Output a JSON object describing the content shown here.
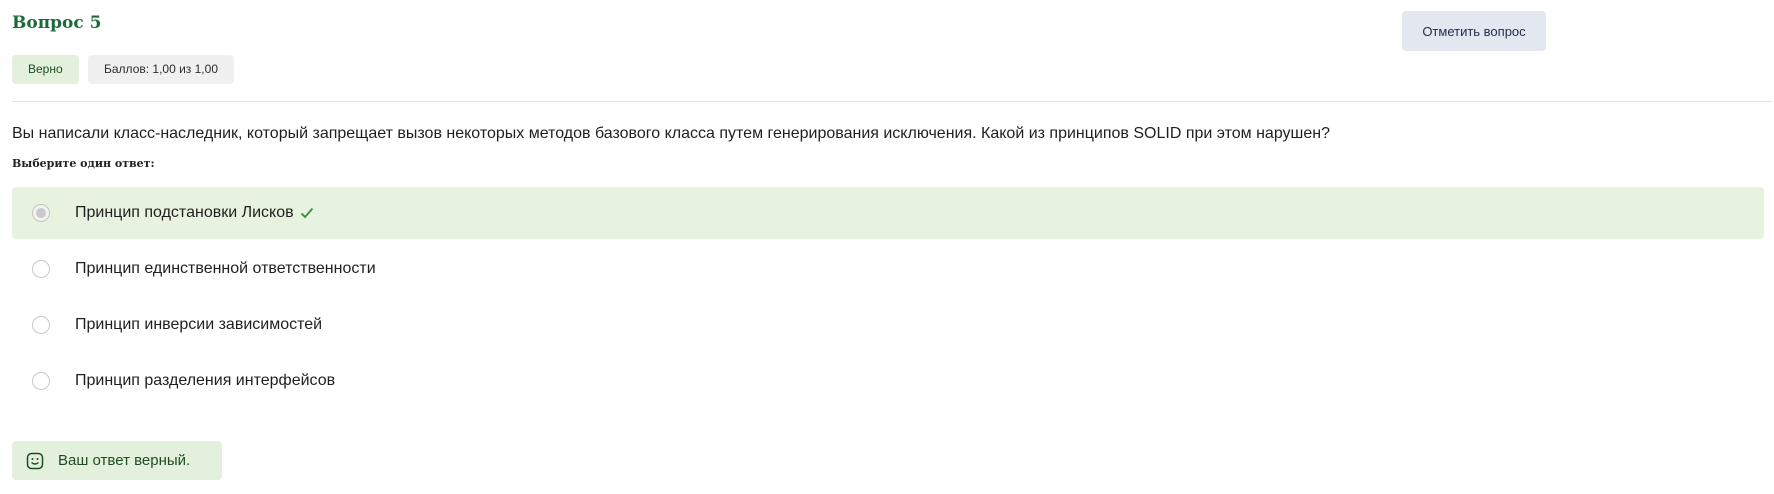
{
  "question": {
    "title": "Вопрос 5",
    "status_badge": "Верно",
    "score_badge": "Баллов: 1,00 из 1,00",
    "flag_button": "Отметить вопрос",
    "text": "Вы написали класс-наследник, который запрещает вызов некоторых методов базового класса путем генерирования исключения. Какой из принципов SOLID при этом нарушен?",
    "prompt": "Выберите один ответ:",
    "options": [
      {
        "label": "Принцип подстановки Лисков",
        "selected": true,
        "correct": true
      },
      {
        "label": "Принцип единственной ответственности",
        "selected": false
      },
      {
        "label": "Принцип инверсии зависимостей",
        "selected": false
      },
      {
        "label": "Принцип разделения интерфейсов",
        "selected": false
      }
    ],
    "feedback": "Ваш ответ верный."
  },
  "colors": {
    "accent_green": "#1b6b3a",
    "selected_bg": "#e8f3df",
    "badge_bg": "#e3f0dc",
    "flag_bg": "#e3e7ef"
  },
  "icons": {
    "check": "check-icon",
    "smile": "smile-icon"
  }
}
